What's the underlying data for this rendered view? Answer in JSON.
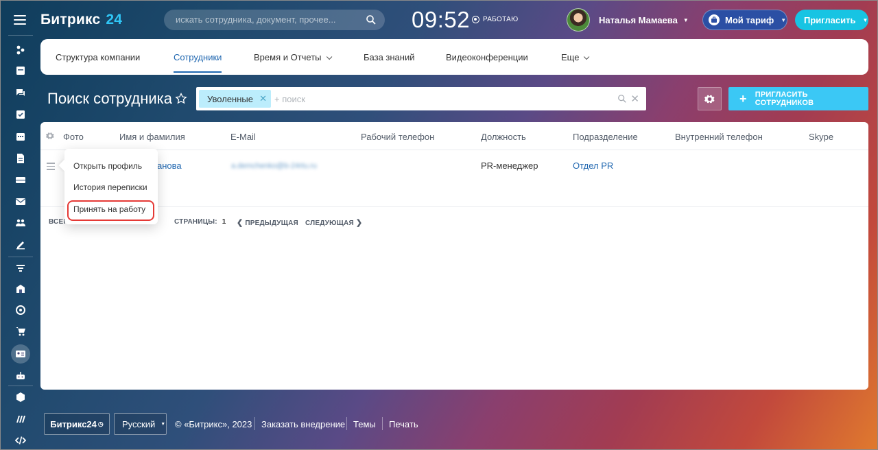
{
  "header": {
    "logo_name": "Битрикс",
    "logo_num": "24",
    "search_placeholder": "искать сотрудника, документ, прочее...",
    "clock": "09:52",
    "work_status": "РАБОТАЮ",
    "user_name": "Наталья Мамаева",
    "tariff_label": "Мой тариф",
    "invite_label": "Пригласить"
  },
  "tabs": [
    {
      "label": "Структура компании"
    },
    {
      "label": "Сотрудники"
    },
    {
      "label": "Время и Отчеты"
    },
    {
      "label": "База знаний"
    },
    {
      "label": "Видеоконференции"
    },
    {
      "label": "Еще"
    }
  ],
  "page": {
    "title": "Поиск сотрудника",
    "filter_chip": "Уволенные",
    "filter_placeholder": "+ поиск",
    "invite_button": "ПРИГЛАСИТЬ СОТРУДНИКОВ"
  },
  "grid": {
    "columns": [
      "Фото",
      "Имя и фамилия",
      "E-Mail",
      "Рабочий телефон",
      "Должность",
      "Подразделение",
      "Внутренний телефон",
      "Skype"
    ],
    "rows": [
      {
        "name": "анова",
        "email": "a.demchenko@b-24rtu.ru",
        "position": "PR-менеджер",
        "department": "Отдел PR"
      }
    ],
    "pager": {
      "total_label": "ВСЕГО",
      "pages_label": "СТРАНИЦЫ:",
      "page_num": "1",
      "prev": "ПРЕДЫДУЩАЯ",
      "next": "СЛЕДУЮЩАЯ"
    }
  },
  "context_menu": {
    "items": [
      "Открыть профиль",
      "История переписки",
      "Принять на работу"
    ],
    "highlighted_item": "Принять на работу"
  },
  "footer": {
    "logo": "Битрикс24",
    "lang": "Русский",
    "copyright": "© «Битрикс», 2023",
    "order": "Заказать внедрение",
    "themes": "Темы",
    "print": "Печать"
  },
  "colors": {
    "accent": "#2067b0",
    "invite": "#3bc8f5",
    "chip": "#bcedfc",
    "highlight_border": "#e53935"
  }
}
